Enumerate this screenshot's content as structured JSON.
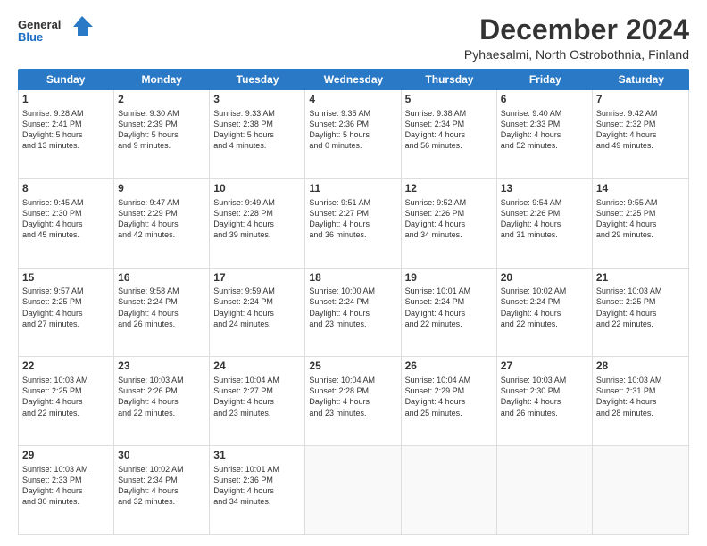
{
  "logo": {
    "general": "General",
    "blue": "Blue"
  },
  "title": "December 2024",
  "subtitle": "Pyhaesalmi, North Ostrobothnia, Finland",
  "days": [
    "Sunday",
    "Monday",
    "Tuesday",
    "Wednesday",
    "Thursday",
    "Friday",
    "Saturday"
  ],
  "weeks": [
    [
      {
        "day": "1",
        "info": "Sunrise: 9:28 AM\nSunset: 2:41 PM\nDaylight: 5 hours\nand 13 minutes."
      },
      {
        "day": "2",
        "info": "Sunrise: 9:30 AM\nSunset: 2:39 PM\nDaylight: 5 hours\nand 9 minutes."
      },
      {
        "day": "3",
        "info": "Sunrise: 9:33 AM\nSunset: 2:38 PM\nDaylight: 5 hours\nand 4 minutes."
      },
      {
        "day": "4",
        "info": "Sunrise: 9:35 AM\nSunset: 2:36 PM\nDaylight: 5 hours\nand 0 minutes."
      },
      {
        "day": "5",
        "info": "Sunrise: 9:38 AM\nSunset: 2:34 PM\nDaylight: 4 hours\nand 56 minutes."
      },
      {
        "day": "6",
        "info": "Sunrise: 9:40 AM\nSunset: 2:33 PM\nDaylight: 4 hours\nand 52 minutes."
      },
      {
        "day": "7",
        "info": "Sunrise: 9:42 AM\nSunset: 2:32 PM\nDaylight: 4 hours\nand 49 minutes."
      }
    ],
    [
      {
        "day": "8",
        "info": "Sunrise: 9:45 AM\nSunset: 2:30 PM\nDaylight: 4 hours\nand 45 minutes."
      },
      {
        "day": "9",
        "info": "Sunrise: 9:47 AM\nSunset: 2:29 PM\nDaylight: 4 hours\nand 42 minutes."
      },
      {
        "day": "10",
        "info": "Sunrise: 9:49 AM\nSunset: 2:28 PM\nDaylight: 4 hours\nand 39 minutes."
      },
      {
        "day": "11",
        "info": "Sunrise: 9:51 AM\nSunset: 2:27 PM\nDaylight: 4 hours\nand 36 minutes."
      },
      {
        "day": "12",
        "info": "Sunrise: 9:52 AM\nSunset: 2:26 PM\nDaylight: 4 hours\nand 34 minutes."
      },
      {
        "day": "13",
        "info": "Sunrise: 9:54 AM\nSunset: 2:26 PM\nDaylight: 4 hours\nand 31 minutes."
      },
      {
        "day": "14",
        "info": "Sunrise: 9:55 AM\nSunset: 2:25 PM\nDaylight: 4 hours\nand 29 minutes."
      }
    ],
    [
      {
        "day": "15",
        "info": "Sunrise: 9:57 AM\nSunset: 2:25 PM\nDaylight: 4 hours\nand 27 minutes."
      },
      {
        "day": "16",
        "info": "Sunrise: 9:58 AM\nSunset: 2:24 PM\nDaylight: 4 hours\nand 26 minutes."
      },
      {
        "day": "17",
        "info": "Sunrise: 9:59 AM\nSunset: 2:24 PM\nDaylight: 4 hours\nand 24 minutes."
      },
      {
        "day": "18",
        "info": "Sunrise: 10:00 AM\nSunset: 2:24 PM\nDaylight: 4 hours\nand 23 minutes."
      },
      {
        "day": "19",
        "info": "Sunrise: 10:01 AM\nSunset: 2:24 PM\nDaylight: 4 hours\nand 22 minutes."
      },
      {
        "day": "20",
        "info": "Sunrise: 10:02 AM\nSunset: 2:24 PM\nDaylight: 4 hours\nand 22 minutes."
      },
      {
        "day": "21",
        "info": "Sunrise: 10:03 AM\nSunset: 2:25 PM\nDaylight: 4 hours\nand 22 minutes."
      }
    ],
    [
      {
        "day": "22",
        "info": "Sunrise: 10:03 AM\nSunset: 2:25 PM\nDaylight: 4 hours\nand 22 minutes."
      },
      {
        "day": "23",
        "info": "Sunrise: 10:03 AM\nSunset: 2:26 PM\nDaylight: 4 hours\nand 22 minutes."
      },
      {
        "day": "24",
        "info": "Sunrise: 10:04 AM\nSunset: 2:27 PM\nDaylight: 4 hours\nand 23 minutes."
      },
      {
        "day": "25",
        "info": "Sunrise: 10:04 AM\nSunset: 2:28 PM\nDaylight: 4 hours\nand 23 minutes."
      },
      {
        "day": "26",
        "info": "Sunrise: 10:04 AM\nSunset: 2:29 PM\nDaylight: 4 hours\nand 25 minutes."
      },
      {
        "day": "27",
        "info": "Sunrise: 10:03 AM\nSunset: 2:30 PM\nDaylight: 4 hours\nand 26 minutes."
      },
      {
        "day": "28",
        "info": "Sunrise: 10:03 AM\nSunset: 2:31 PM\nDaylight: 4 hours\nand 28 minutes."
      }
    ],
    [
      {
        "day": "29",
        "info": "Sunrise: 10:03 AM\nSunset: 2:33 PM\nDaylight: 4 hours\nand 30 minutes."
      },
      {
        "day": "30",
        "info": "Sunrise: 10:02 AM\nSunset: 2:34 PM\nDaylight: 4 hours\nand 32 minutes."
      },
      {
        "day": "31",
        "info": "Sunrise: 10:01 AM\nSunset: 2:36 PM\nDaylight: 4 hours\nand 34 minutes."
      },
      {
        "day": "",
        "info": ""
      },
      {
        "day": "",
        "info": ""
      },
      {
        "day": "",
        "info": ""
      },
      {
        "day": "",
        "info": ""
      }
    ]
  ]
}
